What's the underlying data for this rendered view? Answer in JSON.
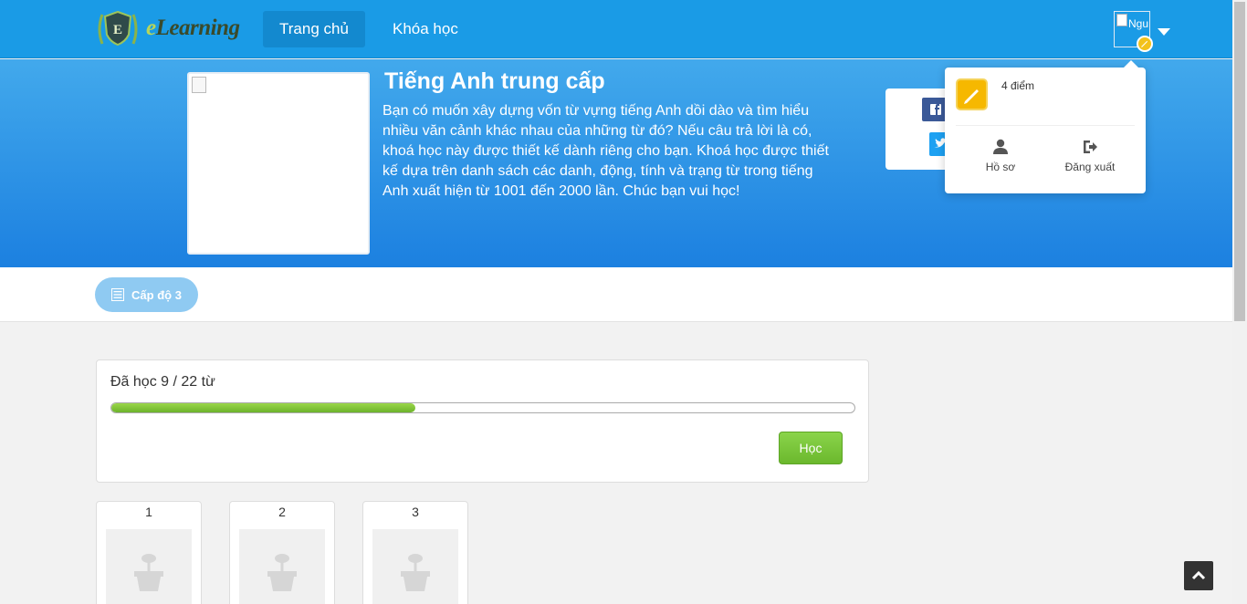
{
  "brand": {
    "name_prefix": "e",
    "name_rest": "Learning",
    "badge_letter": "E"
  },
  "nav": {
    "items": [
      {
        "label": "Trang chủ"
      },
      {
        "label": "Khóa học"
      }
    ]
  },
  "user": {
    "avatar_alt": "Ngu Vă",
    "points": "4 điểm",
    "profile_label": "Hồ sơ",
    "logout_label": "Đăng xuất"
  },
  "course": {
    "title": "Tiếng Anh trung cấp",
    "description": "Bạn có muốn xây dựng vốn từ vựng tiếng Anh dồi dào và tìm hiểu nhiều văn cảnh khác nhau của những từ đó? Nếu câu trả lời là có, khoá học này được thiết kế dành riêng cho bạn. Khoá học được thiết kế dựa trên danh sách các danh, động, tính và trạng từ trong tiếng Anh xuất hiện từ 1001 đến 2000 lần. Chúc bạn vui học!"
  },
  "level": {
    "label": "Cấp độ 3"
  },
  "progress": {
    "text": "Đã học 9 / 22 từ",
    "learned": 9,
    "total": 22,
    "button_label": "Học"
  },
  "words": [
    {
      "index": "1"
    },
    {
      "index": "2"
    },
    {
      "index": "3"
    }
  ],
  "colors": {
    "navbar": "#1a9be6",
    "accent_green": "#7cc63a",
    "level_button": "#8fcaf2"
  },
  "icons": {
    "share": [
      "facebook-icon",
      "twitter-icon"
    ],
    "popover": [
      "pencil-icon",
      "user-icon",
      "sign-out-icon"
    ],
    "scroll": "chevron-up-icon"
  }
}
